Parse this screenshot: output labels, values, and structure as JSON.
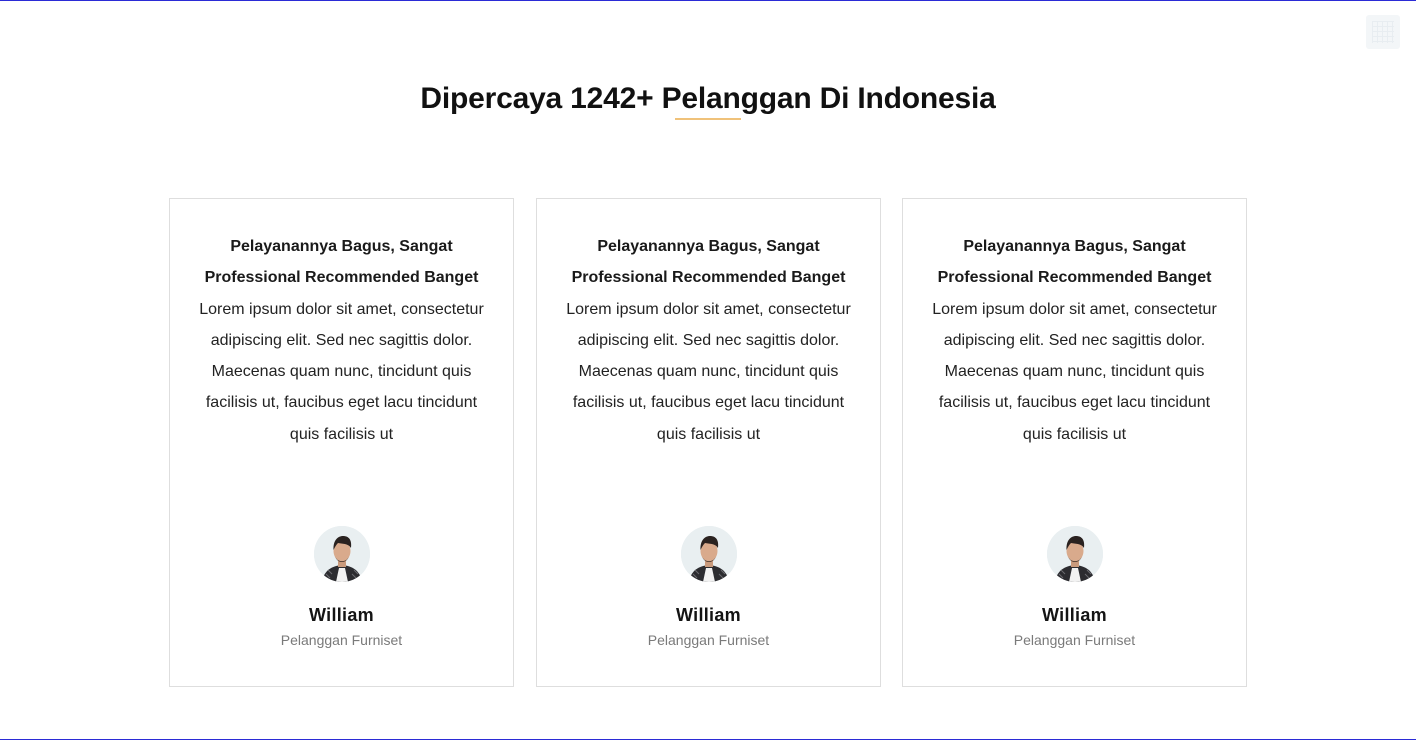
{
  "section": {
    "heading": "Dipercaya 1242+ Pelanggan Di Indonesia",
    "accent_color": "#f0c27a"
  },
  "testimonials": [
    {
      "title": "Pelayanannya Bagus, Sangat Professional Recommended Banget",
      "text": "Lorem ipsum dolor sit amet, consectetur adipiscing elit. Sed nec sagittis dolor. Maecenas quam nunc, tincidunt quis facilisis ut, faucibus eget lacu tincidunt quis facilisis ut",
      "avatar_icon": "avatar-photo",
      "name": "William",
      "role": "Pelanggan Furniset"
    },
    {
      "title": "Pelayanannya Bagus, Sangat Professional Recommended Banget",
      "text": "Lorem ipsum dolor sit amet, consectetur adipiscing elit. Sed nec sagittis dolor. Maecenas quam nunc, tincidunt quis facilisis ut, faucibus eget lacu tincidunt quis facilisis ut",
      "avatar_icon": "avatar-photo",
      "name": "William",
      "role": "Pelanggan Furniset"
    },
    {
      "title": "Pelayanannya Bagus, Sangat Professional Recommended Banget",
      "text": "Lorem ipsum dolor sit amet, consectetur adipiscing elit. Sed nec sagittis dolor. Maecenas quam nunc, tincidunt quis facilisis ut, faucibus eget lacu tincidunt quis facilisis ut",
      "avatar_icon": "avatar-photo",
      "name": "William",
      "role": "Pelanggan Furniset"
    }
  ]
}
